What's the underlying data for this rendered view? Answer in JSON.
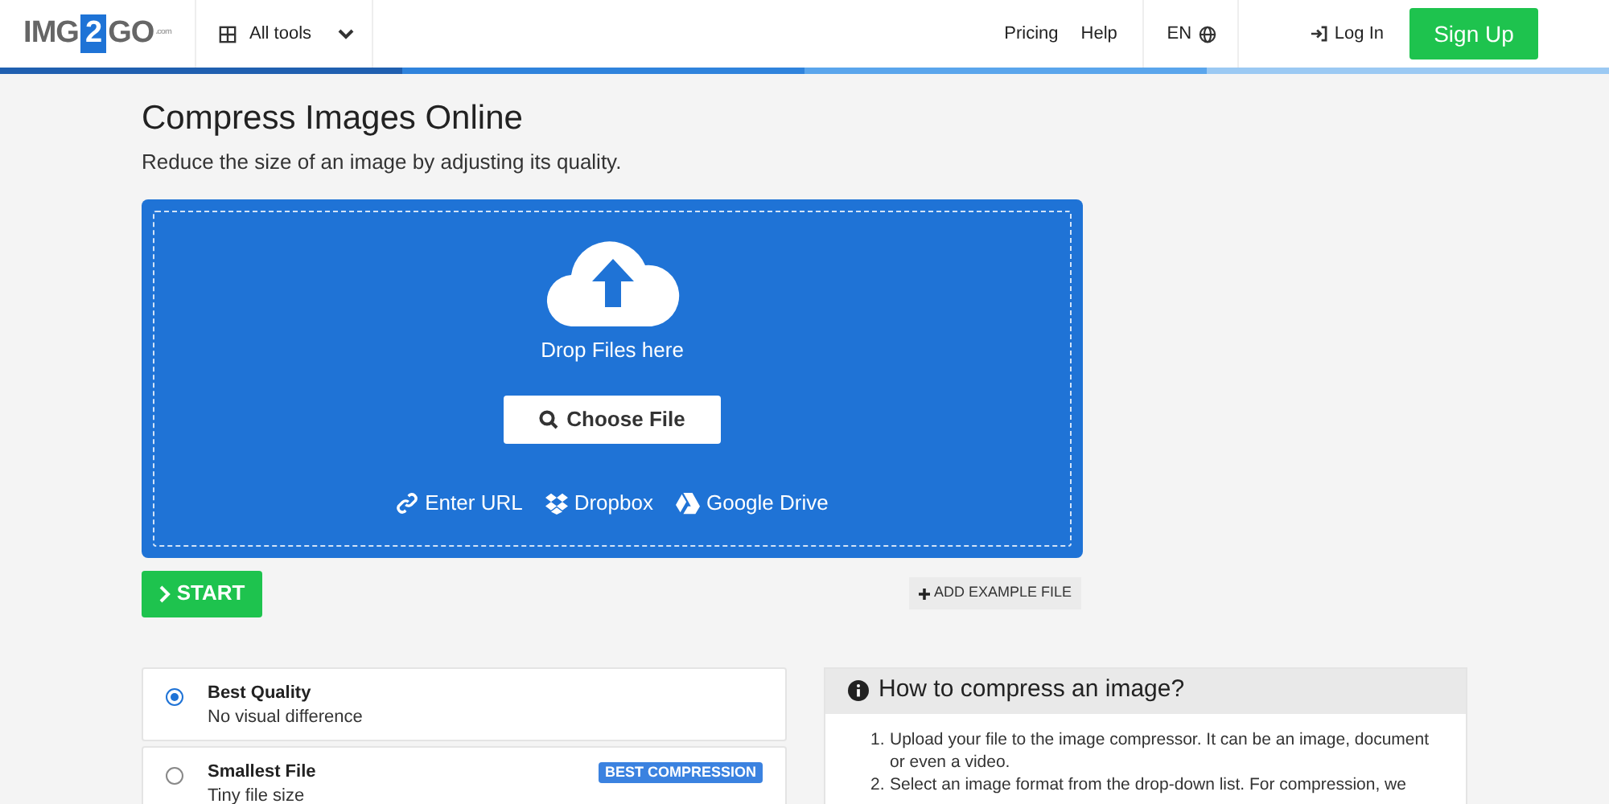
{
  "header": {
    "logo": {
      "left": "IMG",
      "middle": "2",
      "right": "GO",
      "suffix": ".com"
    },
    "tools_menu": {
      "label": "All tools"
    },
    "links": [
      "Pricing",
      "Help"
    ],
    "language": "EN",
    "login": "Log In",
    "signup": "Sign Up"
  },
  "page": {
    "title": "Compress Images Online",
    "subtitle": "Reduce the size of an image by adjusting its quality."
  },
  "upload": {
    "drop_text": "Drop Files here",
    "choose_button": "Choose File",
    "sources": [
      {
        "kind": "link",
        "label": "Enter URL"
      },
      {
        "kind": "box",
        "label": "Dropbox"
      },
      {
        "kind": "drive",
        "label": "Google Drive"
      }
    ]
  },
  "start_button": "START",
  "example_button": "ADD EXAMPLE FILE",
  "options": [
    {
      "title": "Best Quality",
      "description": "No visual difference",
      "selected": true
    },
    {
      "title": "Smallest File",
      "description": "Tiny file size",
      "badge": "BEST COMPRESSION",
      "selected": false
    }
  ],
  "howto": {
    "title": "How to compress an image?",
    "steps": [
      {
        "number": "1.",
        "text": "Upload your file to the image compressor. It can be an image, document or even a video."
      },
      {
        "number": "2.",
        "text": "Select an image format from the drop-down list. For compression, we"
      }
    ]
  }
}
